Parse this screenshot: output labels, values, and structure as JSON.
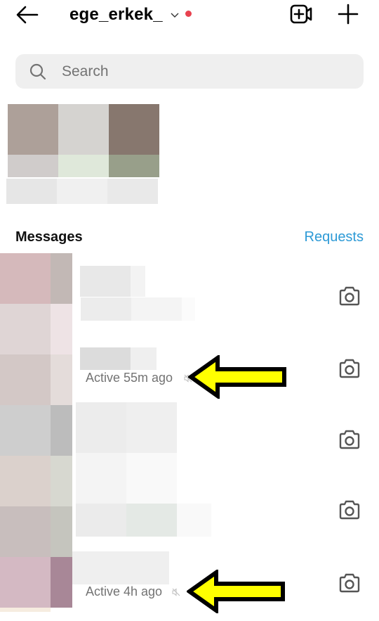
{
  "header": {
    "username": "ege_erkek_",
    "icons": {
      "back": "arrow-left-icon",
      "switch_account": "chevron-down-icon",
      "notification_dot": "red-dot-badge",
      "video_call": "video-add-icon",
      "new_message": "plus-icon"
    },
    "notification_dot_color": "#e8424f"
  },
  "search": {
    "placeholder": "Search",
    "value": "",
    "icon": "search-icon"
  },
  "notes_section": {
    "note": "pixelated (redacted) story/notes avatar thumbnail"
  },
  "messages_section": {
    "title": "Messages",
    "requests_label": "Requests",
    "requests_color": "#2d9ad6"
  },
  "conversations": [
    {
      "name": "redacted",
      "preview": "redacted",
      "status": "",
      "muted": false,
      "action_icon": "camera-icon"
    },
    {
      "name": "redacted",
      "preview": "",
      "status": "Active 55m ago",
      "muted": true,
      "action_icon": "camera-icon"
    },
    {
      "name": "redacted",
      "preview": "redacted",
      "status": "",
      "muted": false,
      "action_icon": "camera-icon"
    },
    {
      "name": "redacted",
      "preview": "redacted",
      "status": "",
      "muted": false,
      "action_icon": "camera-icon"
    },
    {
      "name": "redacted",
      "preview": "",
      "status": "Active 4h ago",
      "muted": true,
      "action_icon": "camera-icon"
    }
  ],
  "annotations": {
    "arrow_color": "#ffff00",
    "arrow_outline": "#000000",
    "targets": [
      "Active 55m ago",
      "Active 4h ago"
    ]
  }
}
